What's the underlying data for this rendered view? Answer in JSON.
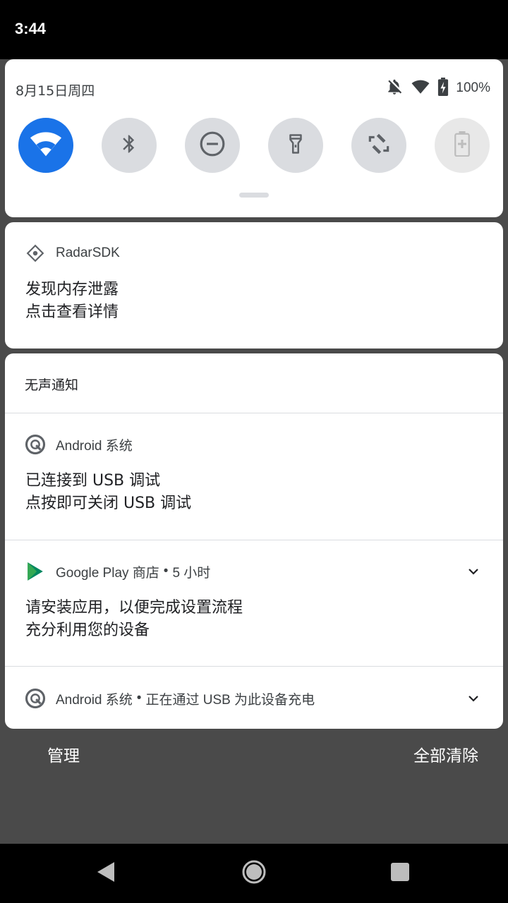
{
  "status_bar": {
    "time": "3:44"
  },
  "quick_settings": {
    "date": "8月15日周四",
    "battery_percent": "100%",
    "tiles": [
      {
        "name": "wifi",
        "icon": "wifi-icon",
        "active": true
      },
      {
        "name": "bluetooth",
        "icon": "bluetooth-icon",
        "active": false
      },
      {
        "name": "do-not-disturb",
        "icon": "do-not-disturb-icon",
        "active": false
      },
      {
        "name": "flashlight",
        "icon": "flashlight-icon",
        "active": false
      },
      {
        "name": "auto-rotate",
        "icon": "auto-rotate-icon",
        "active": false
      },
      {
        "name": "battery-saver",
        "icon": "battery-saver-icon",
        "active": false
      }
    ]
  },
  "notifications": {
    "radar": {
      "app": "RadarSDK",
      "title": "发现内存泄露",
      "text": "点击查看详情"
    },
    "silent_header": "无声通知",
    "usb_debug": {
      "app": "Android 系统",
      "title": "已连接到 USB 调试",
      "text": "点按即可关闭 USB 调试"
    },
    "play": {
      "app": "Google Play 商店",
      "time": "5 小时",
      "title": "请安装应用，以便完成设置流程",
      "text": "充分利用您的设备"
    },
    "usb_charge": {
      "app": "Android 系统",
      "text": "正在通过 USB 为此设备充电"
    }
  },
  "footer": {
    "manage": "管理",
    "clear_all": "全部清除"
  },
  "colors": {
    "accent": "#1a73e8",
    "tile_inactive": "#dadce0",
    "scrim": "#4a4a4a"
  }
}
